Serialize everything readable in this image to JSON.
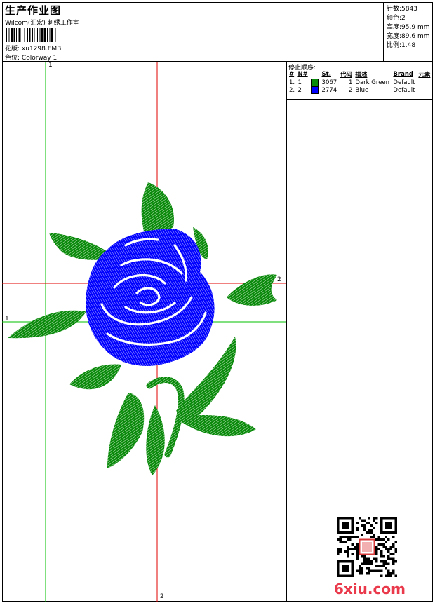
{
  "header": {
    "title": "生产作业图",
    "company": "Wilcom(汇宏) 刺绣工作室",
    "design_label": "花版:",
    "design_value": "xu1298.EMB",
    "color_label": "色位:",
    "color_value": "Colorway 1"
  },
  "stats": [
    {
      "label": "针数:",
      "value": "5843"
    },
    {
      "label": "颜色:",
      "value": "2"
    },
    {
      "label": "高度:",
      "value": "95.9 mm"
    },
    {
      "label": "宽度:",
      "value": "89.6 mm"
    },
    {
      "label": "比例:",
      "value": "1.48"
    }
  ],
  "stop_sequence": {
    "heading": "停止顺序:",
    "columns": [
      "#",
      "N#",
      "St.",
      "代码",
      "描述",
      "Brand",
      "元素"
    ],
    "rows": [
      {
        "num": "1.",
        "n": "1",
        "color": "#0a8a0a",
        "st": "3067",
        "code": "1",
        "desc": "Dark Green",
        "brand": "Default"
      },
      {
        "num": "2.",
        "n": "2",
        "color": "#0000ff",
        "st": "2774",
        "code": "2",
        "desc": "Blue",
        "brand": "Default"
      }
    ]
  },
  "guides": {
    "v1_label": "1",
    "v2_label": "2",
    "h1_label": "1",
    "h2_label": "2"
  },
  "colors": {
    "green_thread": "#0a8a0a",
    "blue_thread": "#0000ff",
    "guide_green": "#00c000",
    "guide_red": "#e00000"
  },
  "watermark": {
    "site": "6xiu.com"
  }
}
